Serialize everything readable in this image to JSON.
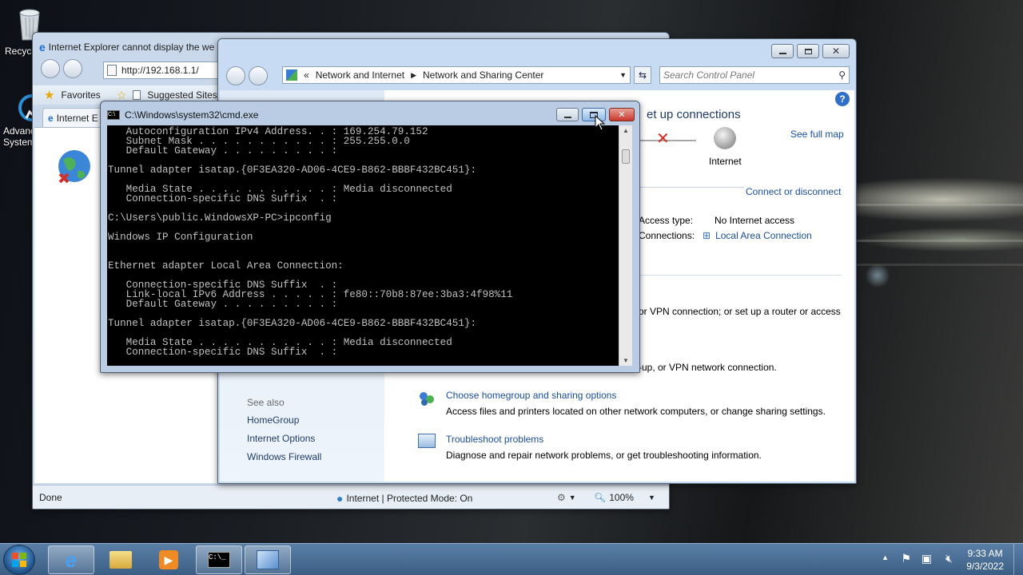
{
  "desktop": {
    "icons": [
      {
        "label": "Recycle Bin"
      },
      {
        "label": "Advanced SystemCare"
      }
    ]
  },
  "ie": {
    "title": "Internet Explorer cannot display the we",
    "address": "http://192.168.1.1/",
    "favorites_label": "Favorites",
    "suggested_label": "Suggested Sites",
    "tab_label": "Internet E",
    "status_done": "Done",
    "status_zone": "Internet | Protected Mode: On",
    "zoom": "100%"
  },
  "cp": {
    "breadcrumb_root": "Network and Internet",
    "breadcrumb_current": "Network and Sharing Center",
    "search_placeholder": "Search Control Panel",
    "heading_partial": "et up connections",
    "see_full_map": "See full map",
    "internet_label": "Internet",
    "connect_disconnect": "Connect or disconnect",
    "access_type_label": "Access type:",
    "access_type_value": "No Internet access",
    "connections_label": "Connections:",
    "connections_value": "Local Area Connection",
    "text_vpn": "or VPN connection; or set up a router or access",
    "text_vpn2": "-up, or VPN network connection.",
    "homegroup_link": "Choose homegroup and sharing options",
    "homegroup_desc": "Access files and printers located on other network computers, or change sharing settings.",
    "troubleshoot_link": "Troubleshoot problems",
    "troubleshoot_desc": "Diagnose and repair network problems, or get troubleshooting information.",
    "see_also": "See also",
    "left_links": [
      "HomeGroup",
      "Internet Options",
      "Windows Firewall"
    ]
  },
  "cmd": {
    "title": "C:\\Windows\\system32\\cmd.exe",
    "lines": [
      "   Autoconfiguration IPv4 Address. . : 169.254.79.152",
      "   Subnet Mask . . . . . . . . . . . : 255.255.0.0",
      "   Default Gateway . . . . . . . . . :",
      "",
      "Tunnel adapter isatap.{0F3EA320-AD06-4CE9-B862-BBBF432BC451}:",
      "",
      "   Media State . . . . . . . . . . . : Media disconnected",
      "   Connection-specific DNS Suffix  . :",
      "",
      "C:\\Users\\public.WindowsXP-PC>ipconfig",
      "",
      "Windows IP Configuration",
      "",
      "",
      "Ethernet adapter Local Area Connection:",
      "",
      "   Connection-specific DNS Suffix  . :",
      "   Link-local IPv6 Address . . . . . : fe80::70b8:87ee:3ba3:4f98%11",
      "   Default Gateway . . . . . . . . . :",
      "",
      "Tunnel adapter isatap.{0F3EA320-AD06-4CE9-B862-BBBF432BC451}:",
      "",
      "   Media State . . . . . . . . . . . : Media disconnected",
      "   Connection-specific DNS Suffix  . :"
    ]
  },
  "taskbar": {
    "time": "9:33 AM",
    "date": "9/3/2022"
  },
  "colors": {
    "link": "#1a4fa3",
    "close_red": "#c8352b",
    "console_bg": "#000000"
  }
}
